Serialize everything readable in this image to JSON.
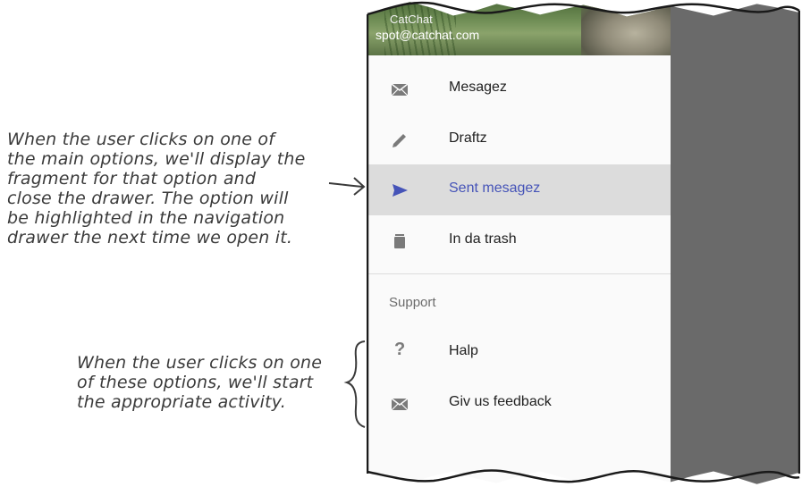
{
  "annotations": {
    "main_options_note": "When the user clicks on one of\nthe main options, we'll display the\nfragment for that option and\nclose the drawer. The option will\nbe highlighted in the navigation\ndrawer the next time we open it.",
    "support_options_note": "When the user clicks on one\nof these options, we'll start\nthe appropriate activity."
  },
  "drawer": {
    "header": {
      "name": "CatChat",
      "email": "spot@catchat.com"
    },
    "main_items": [
      {
        "label": "Mesagez",
        "icon": "mail-icon",
        "selected": false
      },
      {
        "label": "Draftz",
        "icon": "pencil-icon",
        "selected": false
      },
      {
        "label": "Sent mesagez",
        "icon": "send-icon",
        "selected": true
      },
      {
        "label": "In da trash",
        "icon": "trash-icon",
        "selected": false
      }
    ],
    "support": {
      "subheader": "Support",
      "items": [
        {
          "label": "Halp",
          "icon": "help-icon"
        },
        {
          "label": "Giv us feedback",
          "icon": "mail-icon"
        }
      ]
    }
  },
  "colors": {
    "selected_text": "#4654b8",
    "selected_bg": "#dcdcdc",
    "icon_gray": "#7a7a7a",
    "scrim": "#6a6a6a"
  }
}
